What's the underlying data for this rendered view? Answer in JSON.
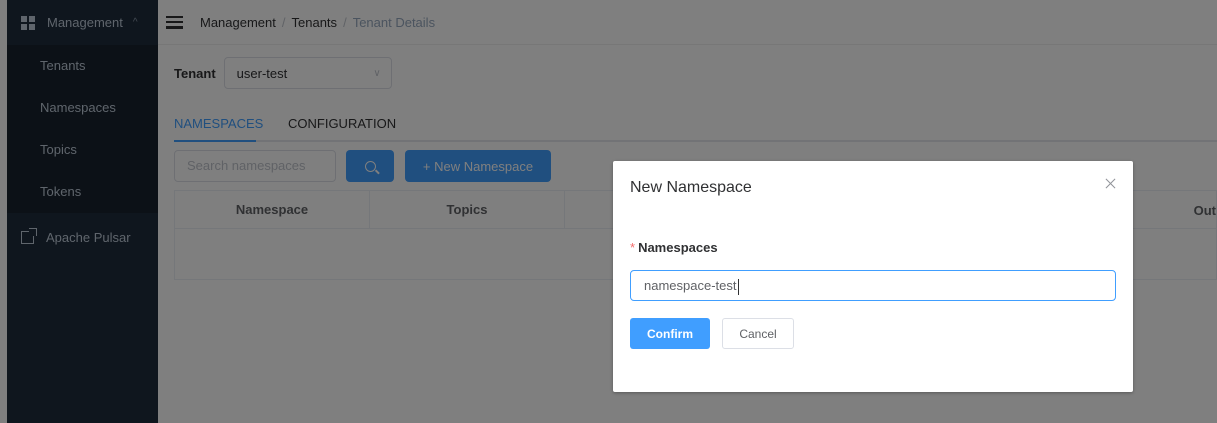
{
  "sidebar": {
    "group_label": "Management",
    "items": [
      {
        "label": "Tenants"
      },
      {
        "label": "Namespaces"
      },
      {
        "label": "Topics"
      },
      {
        "label": "Tokens"
      }
    ],
    "external_link": "Apache Pulsar"
  },
  "breadcrumb": {
    "items": [
      "Management",
      "Tenants",
      "Tenant Details"
    ],
    "separator": "/"
  },
  "tenant": {
    "label": "Tenant",
    "selected": "user-test"
  },
  "tabs": [
    {
      "label": "NAMESPACES",
      "active": true
    },
    {
      "label": "CONFIGURATION",
      "active": false
    }
  ],
  "search": {
    "placeholder": "Search namespaces",
    "new_button_label": "+ New Namespace"
  },
  "table": {
    "columns": [
      "Namespace",
      "Topics",
      "Out"
    ]
  },
  "dialog": {
    "title": "New Namespace",
    "required_mark": "*",
    "field_label": "Namespaces",
    "field_value": "namespace-test",
    "confirm_label": "Confirm",
    "cancel_label": "Cancel"
  },
  "colors": {
    "sidebar_bg": "#1f2d3d",
    "submenu_bg": "#18222e",
    "primary": "#409eff",
    "required": "#f56c6c"
  }
}
